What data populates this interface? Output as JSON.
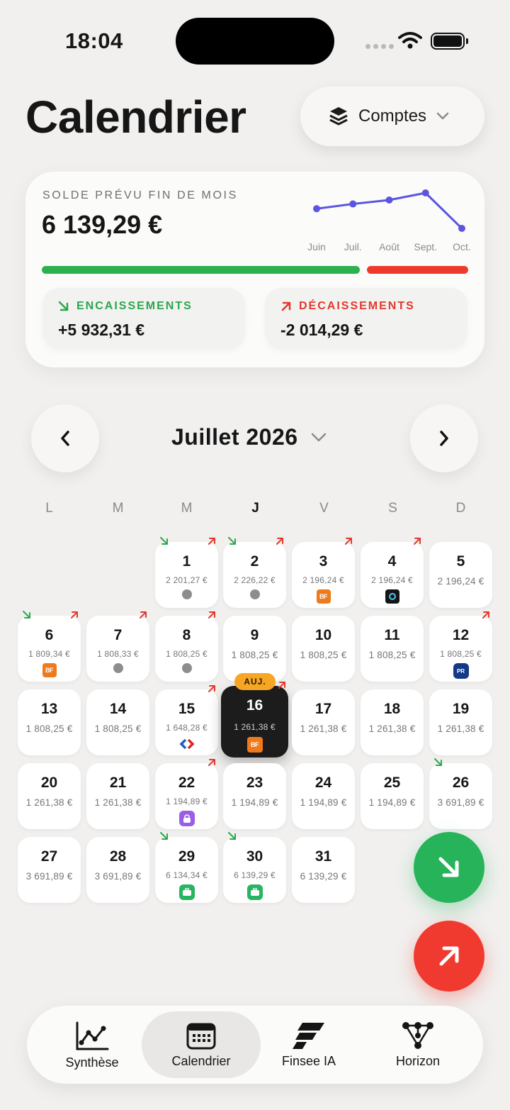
{
  "status": {
    "time": "18:04"
  },
  "header": {
    "title": "Calendrier",
    "accounts_label": "Comptes"
  },
  "summary": {
    "label": "SOLDE PRÉVU FIN DE MOIS",
    "value": "6 139,29 €",
    "in_ratio": 0.746,
    "in_color": "#2bb24c",
    "out_color": "#ee3a2c",
    "inflow": {
      "label": "ENCAISSEMENTS",
      "amount": "+5 932,31 €"
    },
    "outflow": {
      "label": "DÉCAISSEMENTS",
      "amount": "-2 014,29 €"
    }
  },
  "chart_data": {
    "type": "line",
    "categories": [
      "Juin",
      "Juil.",
      "Août",
      "Sept.",
      "Oct."
    ],
    "series": [
      {
        "values": [
          0.2,
          0.32,
          0.42,
          0.6,
          -0.3
        ]
      }
    ],
    "color": "#5b55e0"
  },
  "month": {
    "title": "Juillet 2026"
  },
  "weekdays": [
    "L",
    "M",
    "M",
    "J",
    "V",
    "S",
    "D"
  ],
  "today_badge": "AUJ.",
  "days": [
    {
      "num": "1",
      "bal": "2 201,27 €",
      "col": 2,
      "row": 0,
      "in": true,
      "out": true,
      "mark": "dot"
    },
    {
      "num": "2",
      "bal": "2 226,22 €",
      "col": 3,
      "row": 0,
      "in": true,
      "out": true,
      "mark": "dot"
    },
    {
      "num": "3",
      "bal": "2 196,24 €",
      "col": 4,
      "row": 0,
      "out": true,
      "mark": "bf"
    },
    {
      "num": "4",
      "bal": "2 196,24 €",
      "col": 5,
      "row": 0,
      "out": true,
      "mark": "cam"
    },
    {
      "num": "5",
      "bal": "2 196,24 €",
      "col": 6,
      "row": 0
    },
    {
      "num": "6",
      "bal": "1 809,34 €",
      "col": 0,
      "row": 1,
      "in": true,
      "out": true,
      "mark": "bf"
    },
    {
      "num": "7",
      "bal": "1 808,33 €",
      "col": 1,
      "row": 1,
      "out": true,
      "mark": "dot"
    },
    {
      "num": "8",
      "bal": "1 808,25 €",
      "col": 2,
      "row": 1,
      "out": true,
      "mark": "dot"
    },
    {
      "num": "9",
      "bal": "1 808,25 €",
      "col": 3,
      "row": 1
    },
    {
      "num": "10",
      "bal": "1 808,25 €",
      "col": 4,
      "row": 1
    },
    {
      "num": "11",
      "bal": "1 808,25 €",
      "col": 5,
      "row": 1
    },
    {
      "num": "12",
      "bal": "1 808,25 €",
      "col": 6,
      "row": 1,
      "out": true,
      "mark": "pr"
    },
    {
      "num": "13",
      "bal": "1 808,25 €",
      "col": 0,
      "row": 2
    },
    {
      "num": "14",
      "bal": "1 808,25 €",
      "col": 1,
      "row": 2
    },
    {
      "num": "15",
      "bal": "1 648,28 €",
      "col": 2,
      "row": 2,
      "out": true,
      "mark": "carrefour"
    },
    {
      "num": "16",
      "bal": "1 261,38 €",
      "col": 3,
      "row": 2,
      "out": true,
      "mark": "bf",
      "today": true
    },
    {
      "num": "17",
      "bal": "1 261,38 €",
      "col": 4,
      "row": 2
    },
    {
      "num": "18",
      "bal": "1 261,38 €",
      "col": 5,
      "row": 2
    },
    {
      "num": "19",
      "bal": "1 261,38 €",
      "col": 6,
      "row": 2
    },
    {
      "num": "20",
      "bal": "1 261,38 €",
      "col": 0,
      "row": 3
    },
    {
      "num": "21",
      "bal": "1 261,38 €",
      "col": 1,
      "row": 3
    },
    {
      "num": "22",
      "bal": "1 194,89 €",
      "col": 2,
      "row": 3,
      "out": true,
      "mark": "lock"
    },
    {
      "num": "23",
      "bal": "1 194,89 €",
      "col": 3,
      "row": 3
    },
    {
      "num": "24",
      "bal": "1 194,89 €",
      "col": 4,
      "row": 3
    },
    {
      "num": "25",
      "bal": "1 194,89 €",
      "col": 5,
      "row": 3
    },
    {
      "num": "26",
      "bal": "3 691,89 €",
      "col": 6,
      "row": 3,
      "in": true
    },
    {
      "num": "27",
      "bal": "3 691,89 €",
      "col": 0,
      "row": 4
    },
    {
      "num": "28",
      "bal": "3 691,89 €",
      "col": 1,
      "row": 4
    },
    {
      "num": "29",
      "bal": "6 134,34 €",
      "col": 2,
      "row": 4,
      "in": true,
      "mark": "case"
    },
    {
      "num": "30",
      "bal": "6 139,29 €",
      "col": 3,
      "row": 4,
      "in": true,
      "mark": "case"
    },
    {
      "num": "31",
      "bal": "6 139,29 €",
      "col": 4,
      "row": 4
    }
  ],
  "tabs": [
    {
      "label": "Synthèse",
      "icon": "chart-icon"
    },
    {
      "label": "Calendrier",
      "icon": "calendar-icon",
      "active": true
    },
    {
      "label": "Finsee IA",
      "icon": "finsee-logo-icon"
    },
    {
      "label": "Horizon",
      "icon": "network-icon"
    }
  ]
}
